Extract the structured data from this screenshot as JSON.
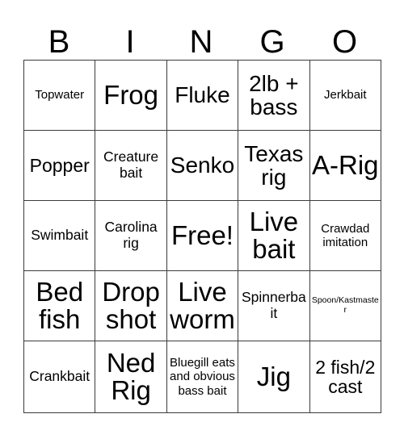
{
  "card": {
    "headers": [
      "B",
      "I",
      "N",
      "G",
      "O"
    ],
    "rows": [
      [
        {
          "text": "Topwater",
          "size": "s"
        },
        {
          "text": "Frog",
          "size": "xxl"
        },
        {
          "text": "Fluke",
          "size": "xl"
        },
        {
          "text": "2lb + bass",
          "size": "xl"
        },
        {
          "text": "Jerkbait",
          "size": "s"
        }
      ],
      [
        {
          "text": "Popper",
          "size": "l"
        },
        {
          "text": "Creature bait",
          "size": "m"
        },
        {
          "text": "Senko",
          "size": "xl"
        },
        {
          "text": "Texas rig",
          "size": "xl"
        },
        {
          "text": "A-Rig",
          "size": "xxl"
        }
      ],
      [
        {
          "text": "Swimbait",
          "size": "m"
        },
        {
          "text": "Carolina rig",
          "size": "m"
        },
        {
          "text": "Free!",
          "size": "xxl"
        },
        {
          "text": "Live bait",
          "size": "xxl"
        },
        {
          "text": "Crawdad imitation",
          "size": "s"
        }
      ],
      [
        {
          "text": "Bed fish",
          "size": "xxl"
        },
        {
          "text": "Drop shot",
          "size": "xxl"
        },
        {
          "text": "Live worm",
          "size": "xxl"
        },
        {
          "text": "Spinnerbait",
          "size": "m"
        },
        {
          "text": "Spoon/Kastmaster",
          "size": "xs"
        }
      ],
      [
        {
          "text": "Crankbait",
          "size": "m"
        },
        {
          "text": "Ned Rig",
          "size": "xxl"
        },
        {
          "text": "Bluegill eats and obvious bass bait",
          "size": "s"
        },
        {
          "text": "Jig",
          "size": "xxl"
        },
        {
          "text": "2 fish/2 cast",
          "size": "l"
        }
      ]
    ]
  }
}
